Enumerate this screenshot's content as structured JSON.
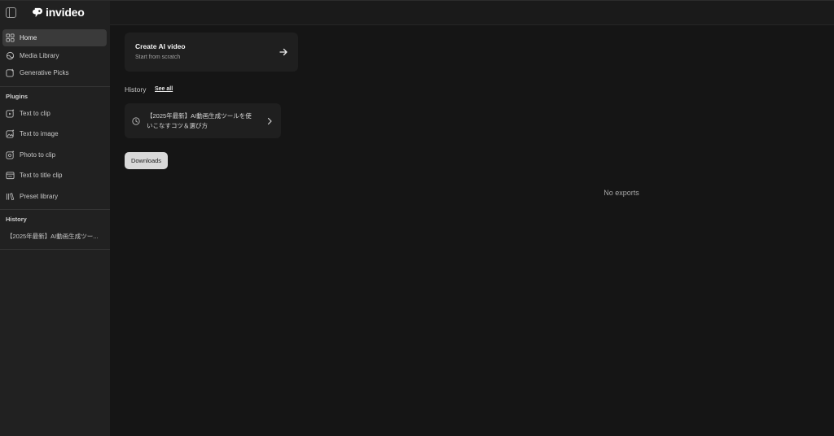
{
  "brand": {
    "name": "invideo"
  },
  "sidebar": {
    "nav": [
      {
        "label": "Home",
        "icon": "grid-icon",
        "active": true
      },
      {
        "label": "Media Library",
        "icon": "media-library-icon"
      },
      {
        "label": "Generative Picks",
        "icon": "generative-picks-icon"
      }
    ],
    "plugins_title": "Plugins",
    "plugins": [
      {
        "label": "Text to clip",
        "icon": "text-to-clip-icon"
      },
      {
        "label": "Text to image",
        "icon": "text-to-image-icon"
      },
      {
        "label": "Photo to clip",
        "icon": "photo-to-clip-icon"
      },
      {
        "label": "Text to title clip",
        "icon": "text-to-title-clip-icon"
      },
      {
        "label": "Preset library",
        "icon": "preset-library-icon"
      }
    ],
    "history_title": "History",
    "history_items": [
      {
        "label": "【2025年最新】AI動画生成ツー..."
      }
    ]
  },
  "main": {
    "create_card": {
      "title": "Create AI video",
      "subtitle": "Start from scratch"
    },
    "history": {
      "label": "History",
      "see_all": "See all",
      "item_title": "【2025年最新】AI動画生成ツールを使いこなすコツ＆選び方"
    },
    "downloads_label": "Downloads",
    "empty_state": "No exports"
  },
  "colors": {
    "background": "#151515",
    "sidebar": "#212121",
    "card": "#1f1f1f",
    "active_nav": "#3a3a3a",
    "button": "#d9d9d9"
  }
}
